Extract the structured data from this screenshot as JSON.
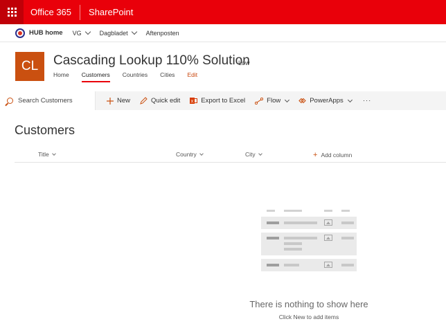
{
  "suite": {
    "brand": "Office 365",
    "app": "SharePoint"
  },
  "hub": {
    "title": "HUB home",
    "links": [
      "VG",
      "Dagbladet",
      "Aftenposten"
    ]
  },
  "site": {
    "logo_text": "CL",
    "title": "Cascading Lookup 110% Solution",
    "classification": "Low",
    "nav": [
      "Home",
      "Customers",
      "Countries",
      "Cities",
      "Edit"
    ],
    "active_nav": "Customers"
  },
  "commandbar": {
    "search_placeholder": "Search Customers",
    "new_label": "New",
    "quick_edit_label": "Quick edit",
    "export_label": "Export to Excel",
    "flow_label": "Flow",
    "powerapps_label": "PowerApps",
    "more_label": "···"
  },
  "list": {
    "title": "Customers",
    "columns": [
      "Title",
      "Country",
      "City"
    ],
    "add_column_label": "Add column"
  },
  "empty_state": {
    "title": "There is nothing to show here",
    "subtitle": "Click New to add items"
  },
  "colors": {
    "suite_red": "#e9000a",
    "accent_orange": "#ca5010"
  }
}
